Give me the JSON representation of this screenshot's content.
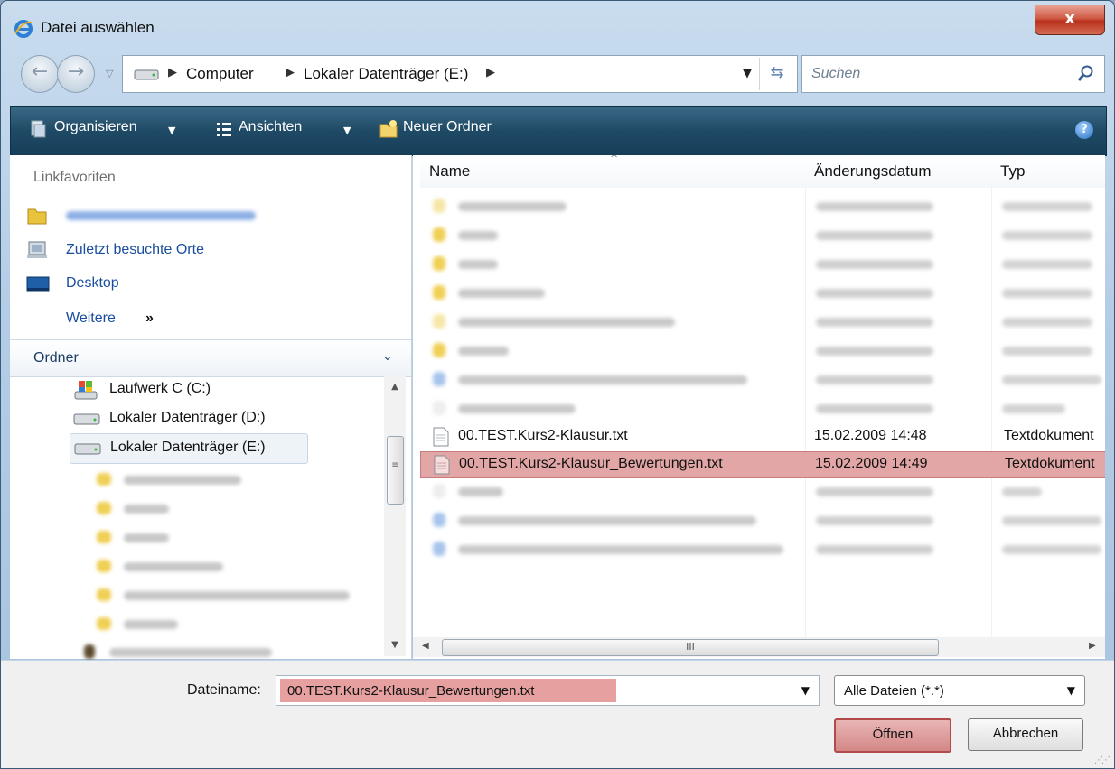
{
  "window": {
    "title": "Datei auswählen",
    "close_glyph": "x"
  },
  "address": {
    "crumbs": [
      "Computer",
      "Lokaler Datenträger (E:)"
    ],
    "search_placeholder": "Suchen"
  },
  "toolbar": {
    "organize": "Organisieren",
    "views": "Ansichten",
    "new_folder": "Neuer Ordner",
    "help_glyph": "?"
  },
  "left": {
    "favorites_heading": "Linkfavoriten",
    "favorites": [
      {
        "label": "",
        "icon": "folder-icon",
        "blurred": true
      },
      {
        "label": "Zuletzt besuchte Orte",
        "icon": "recent-places-icon"
      },
      {
        "label": "Desktop",
        "icon": "desktop-icon"
      }
    ],
    "more_label": "Weitere",
    "more_glyph": "»",
    "folders_heading": "Ordner",
    "tree": [
      {
        "label": "Laufwerk C (C:)",
        "icon": "system-drive-icon"
      },
      {
        "label": "Lokaler Datenträger (D:)",
        "icon": "drive-icon"
      },
      {
        "label": "Lokaler Datenträger (E:)",
        "icon": "drive-icon",
        "selected": true
      }
    ]
  },
  "columns": {
    "name": "Name",
    "date": "Änderungsdatum",
    "type": "Typ"
  },
  "files": [
    {
      "name": "00.TEST.Kurs2-Klausur.txt",
      "date": "15.02.2009 14:48",
      "type": "Textdokument",
      "selected": false
    },
    {
      "name": "00.TEST.Kurs2-Klausur_Bewertungen.txt",
      "date": "15.02.2009 14:49",
      "type": "Textdokument",
      "selected": true
    }
  ],
  "hscroll_grip": "III",
  "bottom": {
    "filename_label": "Dateiname:",
    "filename_value": "00.TEST.Kurs2-Klausur_Bewertungen.txt",
    "filter_value": "Alle Dateien (*.*)",
    "open_label": "Öffnen",
    "cancel_label": "Abbrechen"
  },
  "colors": {
    "highlight": "#e6a0a0",
    "toolbar": "#1f4a66",
    "link": "#1a4ea0"
  }
}
